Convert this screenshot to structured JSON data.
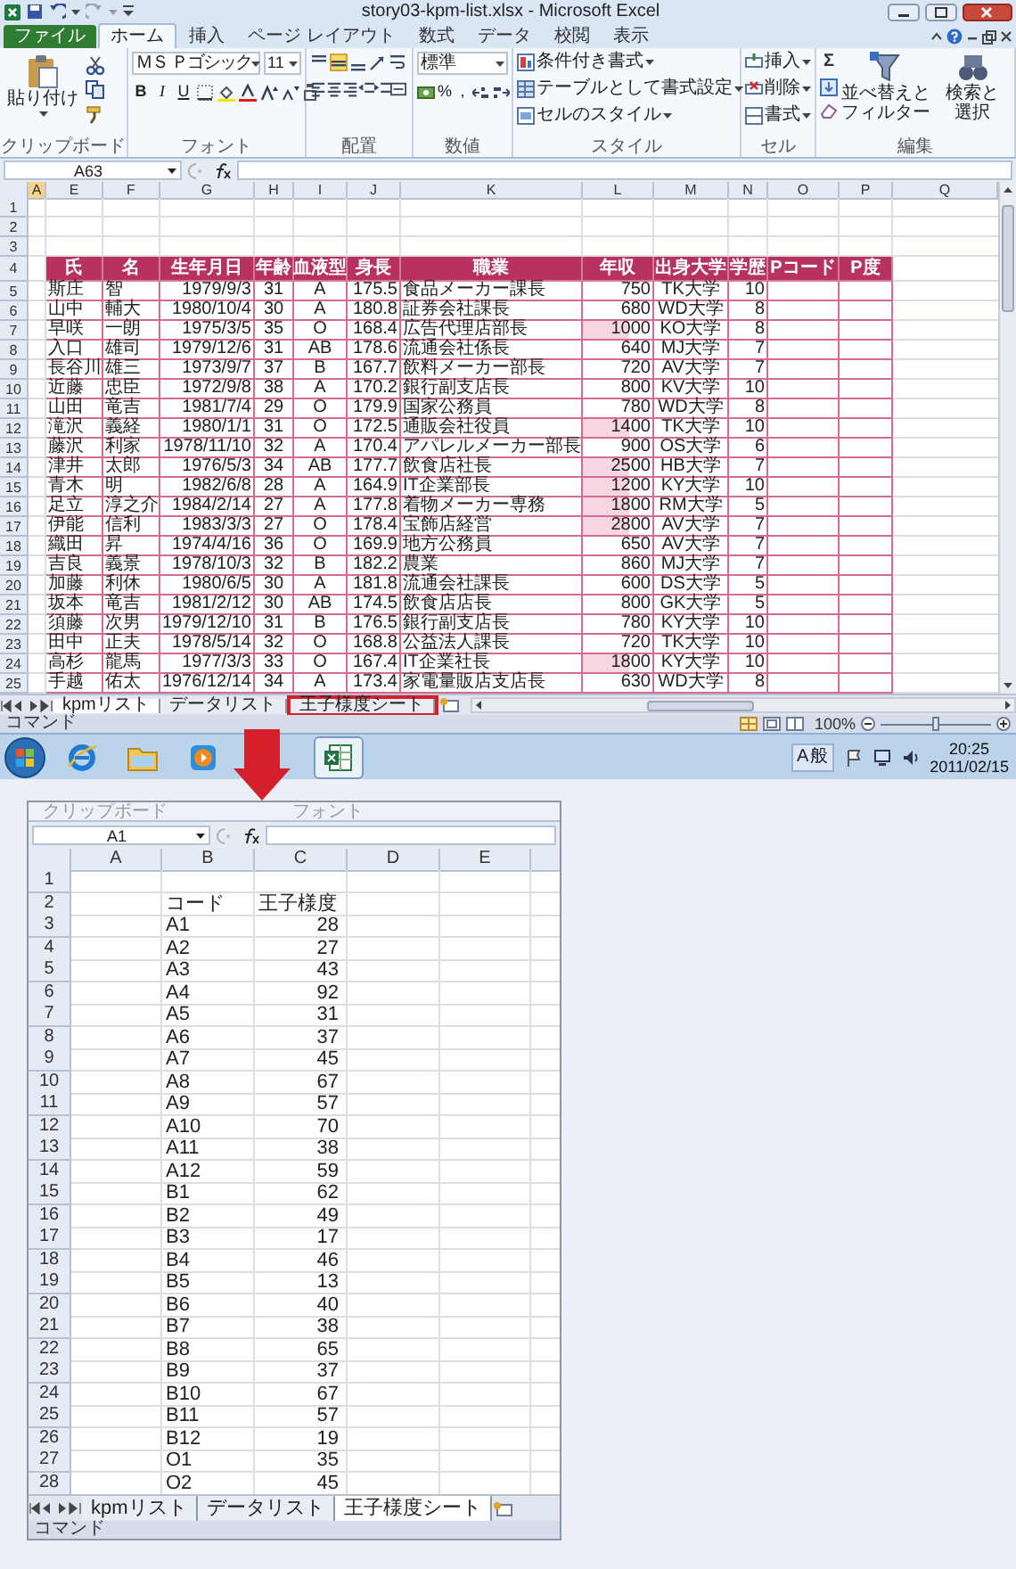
{
  "title_bar": {
    "title": "story03-kpm-list.xlsx - Microsoft Excel"
  },
  "ribbon_tabs": [
    {
      "label": "ファイル",
      "kind": "file",
      "selected": false
    },
    {
      "label": "ホーム",
      "kind": "tab",
      "selected": true
    },
    {
      "label": "挿入",
      "kind": "tab",
      "selected": false
    },
    {
      "label": "ページ レイアウト",
      "kind": "tab",
      "selected": false
    },
    {
      "label": "数式",
      "kind": "tab",
      "selected": false
    },
    {
      "label": "データ",
      "kind": "tab",
      "selected": false
    },
    {
      "label": "校閲",
      "kind": "tab",
      "selected": false
    },
    {
      "label": "表示",
      "kind": "tab",
      "selected": false
    }
  ],
  "ribbon": {
    "clipboard": {
      "label": "クリップボード",
      "paste": "貼り付け"
    },
    "font": {
      "label": "フォント",
      "font_name": "ＭＳ Ｐゴシック",
      "font_size": "11",
      "styles": [
        "B",
        "I",
        "U"
      ]
    },
    "alignment": {
      "label": "配置"
    },
    "number": {
      "label": "数値",
      "format": "標準",
      "symbols": [
        "%",
        ","
      ]
    },
    "styles": {
      "label": "スタイル",
      "items": [
        "条件付き書式",
        "テーブルとして書式設定",
        "セルのスタイル"
      ]
    },
    "cells": {
      "label": "セル",
      "items": [
        "挿入",
        "削除",
        "書式"
      ]
    },
    "editing": {
      "label": "編集",
      "sum": "Σ",
      "buttons": [
        {
          "lines": [
            "並べ替えと",
            "フィルター"
          ]
        },
        {
          "lines": [
            "検索と",
            "選択"
          ]
        }
      ]
    }
  },
  "formula_bar": {
    "name_box": "A63"
  },
  "sheet": {
    "columns": [
      "A",
      "E",
      "F",
      "G",
      "H",
      "I",
      "J",
      "K",
      "L",
      "M",
      "N",
      "O",
      "P",
      "Q"
    ],
    "rows": [
      {
        "number": "1",
        "kind": "blank"
      },
      {
        "number": "2",
        "kind": "blank"
      },
      {
        "number": "3",
        "kind": "blank"
      },
      {
        "number": "4",
        "kind": "header",
        "cells": [
          "氏",
          "名",
          "生年月日",
          "年齢",
          "血液型",
          "身長",
          "職業",
          "年収",
          "出身大学",
          "学歴",
          "Pコード",
          "P度"
        ]
      },
      {
        "number": "5",
        "kind": "data",
        "bar": false,
        "cells": [
          "斯庄",
          "智",
          "1979/9/3",
          "31",
          "A",
          "175.5",
          "食品メーカー課長",
          "750",
          "TK大学",
          "10"
        ]
      },
      {
        "number": "6",
        "kind": "data",
        "bar": false,
        "cells": [
          "山中",
          "輔大",
          "1980/10/4",
          "30",
          "A",
          "180.8",
          "証券会社課長",
          "680",
          "WD大学",
          "8"
        ]
      },
      {
        "number": "7",
        "kind": "data",
        "bar": true,
        "cells": [
          "早咲",
          "一朗",
          "1975/3/5",
          "35",
          "O",
          "168.4",
          "広告代理店部長",
          "1000",
          "KO大学",
          "8"
        ]
      },
      {
        "number": "8",
        "kind": "data",
        "bar": false,
        "cells": [
          "入口",
          "雄司",
          "1979/12/6",
          "31",
          "AB",
          "178.6",
          "流通会社係長",
          "640",
          "MJ大学",
          "7"
        ]
      },
      {
        "number": "9",
        "kind": "data",
        "bar": false,
        "cells": [
          "長谷川",
          "雄三",
          "1973/9/7",
          "37",
          "B",
          "167.7",
          "飲料メーカー部長",
          "720",
          "AV大学",
          "7"
        ]
      },
      {
        "number": "10",
        "kind": "data",
        "bar": false,
        "cells": [
          "近藤",
          "忠臣",
          "1972/9/8",
          "38",
          "A",
          "170.2",
          "銀行副支店長",
          "800",
          "KV大学",
          "10"
        ]
      },
      {
        "number": "11",
        "kind": "data",
        "bar": false,
        "cells": [
          "山田",
          "竜吉",
          "1981/7/4",
          "29",
          "O",
          "179.9",
          "国家公務員",
          "780",
          "WD大学",
          "8"
        ]
      },
      {
        "number": "12",
        "kind": "data",
        "bar": true,
        "cells": [
          "滝沢",
          "義経",
          "1980/1/1",
          "31",
          "O",
          "172.5",
          "通販会社役員",
          "1400",
          "TK大学",
          "10"
        ]
      },
      {
        "number": "13",
        "kind": "data",
        "bar": false,
        "cells": [
          "藤沢",
          "利家",
          "1978/11/10",
          "32",
          "A",
          "170.4",
          "アパレルメーカー部長",
          "900",
          "OS大学",
          "6"
        ]
      },
      {
        "number": "14",
        "kind": "data",
        "bar": true,
        "cells": [
          "津井",
          "太郎",
          "1976/5/3",
          "34",
          "AB",
          "177.7",
          "飲食店社長",
          "2500",
          "HB大学",
          "7"
        ]
      },
      {
        "number": "15",
        "kind": "data",
        "bar": true,
        "cells": [
          "青木",
          "明",
          "1982/6/8",
          "28",
          "A",
          "164.9",
          "IT企業部長",
          "1200",
          "KY大学",
          "10"
        ]
      },
      {
        "number": "16",
        "kind": "data",
        "bar": true,
        "cells": [
          "足立",
          "淳之介",
          "1984/2/14",
          "27",
          "A",
          "177.8",
          "着物メーカー専務",
          "1800",
          "RM大学",
          "5"
        ]
      },
      {
        "number": "17",
        "kind": "data",
        "bar": true,
        "cells": [
          "伊能",
          "信利",
          "1983/3/3",
          "27",
          "O",
          "178.4",
          "宝飾店経営",
          "2800",
          "AV大学",
          "7"
        ]
      },
      {
        "number": "18",
        "kind": "data",
        "bar": false,
        "cells": [
          "織田",
          "昇",
          "1974/4/16",
          "36",
          "O",
          "169.9",
          "地方公務員",
          "650",
          "AV大学",
          "7"
        ]
      },
      {
        "number": "19",
        "kind": "data",
        "bar": false,
        "cells": [
          "吉良",
          "義景",
          "1978/10/3",
          "32",
          "B",
          "182.2",
          "農業",
          "860",
          "MJ大学",
          "7"
        ]
      },
      {
        "number": "20",
        "kind": "data",
        "bar": false,
        "cells": [
          "加藤",
          "利休",
          "1980/6/5",
          "30",
          "A",
          "181.8",
          "流通会社課長",
          "600",
          "DS大学",
          "5"
        ]
      },
      {
        "number": "21",
        "kind": "data",
        "bar": false,
        "cells": [
          "坂本",
          "竜吉",
          "1981/2/12",
          "30",
          "AB",
          "174.5",
          "飲食店店長",
          "800",
          "GK大学",
          "5"
        ]
      },
      {
        "number": "22",
        "kind": "data",
        "bar": false,
        "cells": [
          "須藤",
          "次男",
          "1979/12/10",
          "31",
          "B",
          "176.5",
          "銀行副支店長",
          "780",
          "KY大学",
          "10"
        ]
      },
      {
        "number": "23",
        "kind": "data",
        "bar": false,
        "cells": [
          "田中",
          "正夫",
          "1978/5/14",
          "32",
          "O",
          "168.8",
          "公益法人課長",
          "720",
          "TK大学",
          "10"
        ]
      },
      {
        "number": "24",
        "kind": "data",
        "bar": true,
        "cells": [
          "高杉",
          "龍馬",
          "1977/3/3",
          "33",
          "O",
          "167.4",
          "IT企業社長",
          "1800",
          "KY大学",
          "10"
        ]
      },
      {
        "number": "25",
        "kind": "data",
        "bar": false,
        "cells": [
          "手越",
          "佑太",
          "1976/12/14",
          "34",
          "A",
          "173.4",
          "家電量販店支店長",
          "630",
          "WD大学",
          "8"
        ]
      }
    ]
  },
  "sheet_tabs": [
    {
      "label": "kpmリスト",
      "selected": true,
      "outlined": false
    },
    {
      "label": "データリスト",
      "selected": false,
      "outlined": false
    },
    {
      "label": "王子様度シート",
      "selected": false,
      "outlined": true
    }
  ],
  "status_bar": {
    "mode": "コマンド",
    "zoom": "100%",
    "zoom_slider": {
      "level": 0.5
    }
  },
  "taskbar": {
    "apps": [
      {
        "kind": "browser",
        "active": false
      },
      {
        "kind": "folder",
        "active": false
      },
      {
        "kind": "media",
        "active": false
      },
      {
        "kind": "spreadsheet",
        "active": true
      }
    ],
    "ime": [
      "A",
      "般"
    ],
    "clock": {
      "time": "20:25",
      "date": "2011/02/15"
    }
  },
  "zoomed_view": {
    "ribbon_fragment": [
      "クリップボード",
      "フォント"
    ],
    "name_box": "A1",
    "columns": [
      "A",
      "B",
      "C",
      "D",
      "E"
    ],
    "rows": [
      {
        "number": "1",
        "kind": "blank"
      },
      {
        "number": "2",
        "kind": "header",
        "code": "コード",
        "score": "王子様度"
      },
      {
        "number": "3",
        "kind": "data",
        "code": "A1",
        "score": "28"
      },
      {
        "number": "4",
        "kind": "data",
        "code": "A2",
        "score": "27"
      },
      {
        "number": "5",
        "kind": "data",
        "code": "A3",
        "score": "43"
      },
      {
        "number": "6",
        "kind": "data",
        "code": "A4",
        "score": "92"
      },
      {
        "number": "7",
        "kind": "data",
        "code": "A5",
        "score": "31"
      },
      {
        "number": "8",
        "kind": "data",
        "code": "A6",
        "score": "37"
      },
      {
        "number": "9",
        "kind": "data",
        "code": "A7",
        "score": "45"
      },
      {
        "number": "10",
        "kind": "data",
        "code": "A8",
        "score": "67"
      },
      {
        "number": "11",
        "kind": "data",
        "code": "A9",
        "score": "57"
      },
      {
        "number": "12",
        "kind": "data",
        "code": "A10",
        "score": "70"
      },
      {
        "number": "13",
        "kind": "data",
        "code": "A11",
        "score": "38"
      },
      {
        "number": "14",
        "kind": "data",
        "code": "A12",
        "score": "59"
      },
      {
        "number": "15",
        "kind": "data",
        "code": "B1",
        "score": "62"
      },
      {
        "number": "16",
        "kind": "data",
        "code": "B2",
        "score": "49"
      },
      {
        "number": "17",
        "kind": "data",
        "code": "B3",
        "score": "17"
      },
      {
        "number": "18",
        "kind": "data",
        "code": "B4",
        "score": "46"
      },
      {
        "number": "19",
        "kind": "data",
        "code": "B5",
        "score": "13"
      },
      {
        "number": "20",
        "kind": "data",
        "code": "B6",
        "score": "40"
      },
      {
        "number": "21",
        "kind": "data",
        "code": "B7",
        "score": "38"
      },
      {
        "number": "22",
        "kind": "data",
        "code": "B8",
        "score": "65"
      },
      {
        "number": "23",
        "kind": "data",
        "code": "B9",
        "score": "37"
      },
      {
        "number": "24",
        "kind": "data",
        "code": "B10",
        "score": "67"
      },
      {
        "number": "25",
        "kind": "data",
        "code": "B11",
        "score": "57"
      },
      {
        "number": "26",
        "kind": "data",
        "code": "B12",
        "score": "19"
      },
      {
        "number": "27",
        "kind": "data",
        "code": "O1",
        "score": "35"
      },
      {
        "number": "28",
        "kind": "data",
        "code": "O2",
        "score": "45"
      }
    ],
    "sheet_tabs": [
      {
        "label": "kpmリスト",
        "selected": false
      },
      {
        "label": "データリスト",
        "selected": false
      },
      {
        "label": "王子様度シート",
        "selected": true
      }
    ],
    "status": "コマンド"
  }
}
